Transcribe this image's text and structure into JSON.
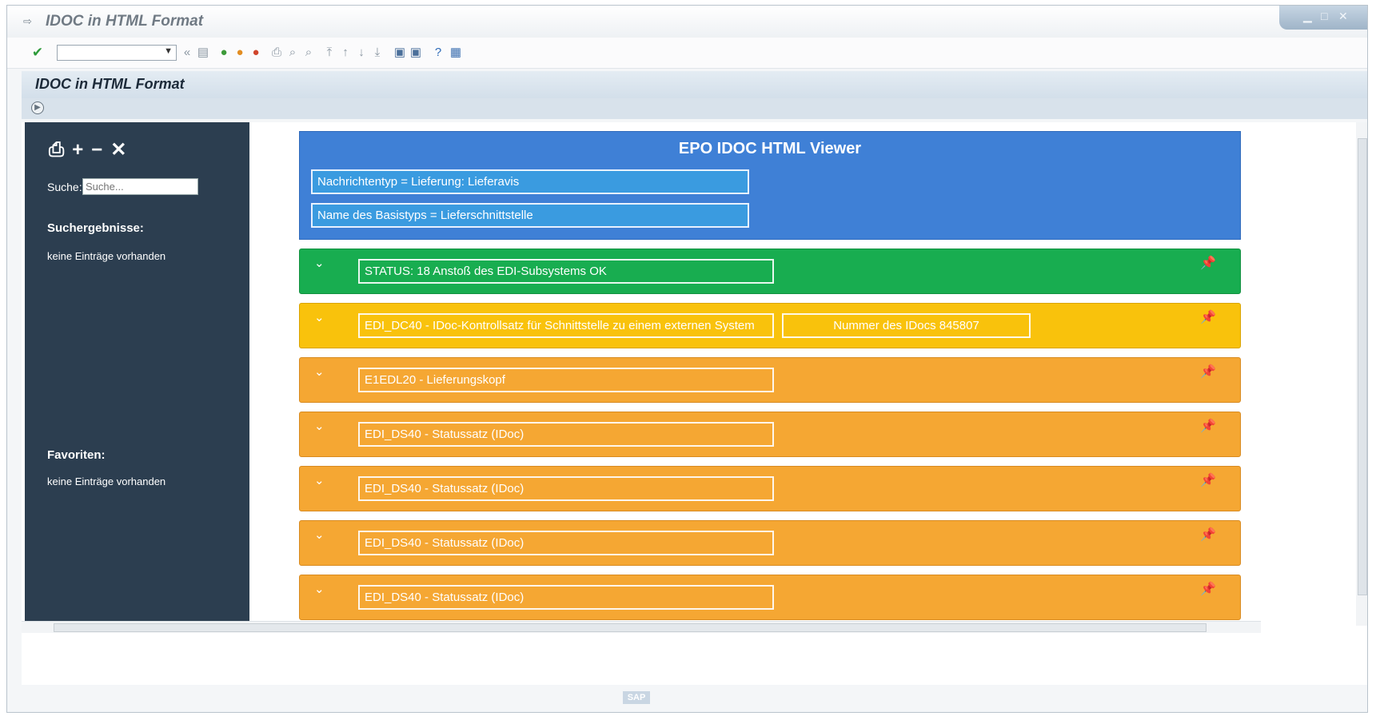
{
  "window": {
    "title": "IDOC in HTML Format"
  },
  "app": {
    "title": "IDOC in HTML Format"
  },
  "sidebar": {
    "search_label": "Suche:",
    "search_placeholder": "Suche...",
    "results_heading": "Suchergebnisse:",
    "results_empty": "keine Einträge vorhanden",
    "favorites_heading": "Favoriten:",
    "favorites_empty": "keine Einträge vorhanden"
  },
  "viewer": {
    "title": "EPO IDOC HTML Viewer",
    "message_type": "Nachrichtentyp = Lieferung: Lieferavis",
    "basic_type": "Name des Basistyps = Lieferschnittstelle"
  },
  "segments": [
    {
      "label": "STATUS:  18  Anstoß des EDI-Subsystems OK",
      "color": "#18ad50"
    },
    {
      "label": "EDI_DC40 - IDoc-Kontrollsatz für Schnittstelle zu einem externen System",
      "extra": "Nummer des IDocs  845807",
      "color": "#f9c20c"
    },
    {
      "label": "E1EDL20 - Lieferungskopf",
      "color": "#f5a733"
    },
    {
      "label": "EDI_DS40 - Statussatz (IDoc)",
      "color": "#f5a733"
    },
    {
      "label": "EDI_DS40 - Statussatz (IDoc)",
      "color": "#f5a733"
    },
    {
      "label": "EDI_DS40 - Statussatz (IDoc)",
      "color": "#f5a733"
    },
    {
      "label": "EDI_DS40 - Statussatz (IDoc)",
      "color": "#f5a733"
    }
  ],
  "status_logo": "SAP"
}
